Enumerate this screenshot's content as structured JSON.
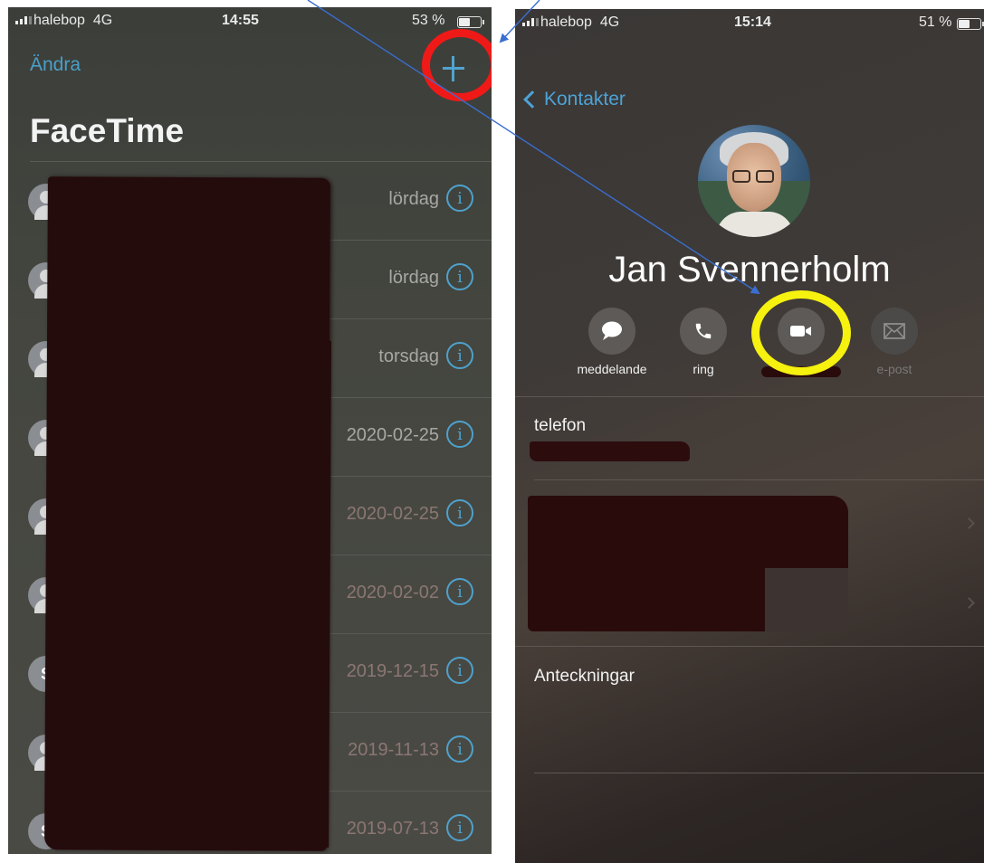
{
  "left_phone": {
    "status": {
      "carrier": "halebop",
      "network": "4G",
      "time": "14:55",
      "battery": "53 %"
    },
    "edit_label": "Ändra",
    "title": "FaceTime",
    "rows": [
      {
        "when": "lördag",
        "avatar": ""
      },
      {
        "when": "lördag",
        "avatar": ""
      },
      {
        "when": "torsdag",
        "avatar": ""
      },
      {
        "when": "2020-02-25",
        "avatar": ""
      },
      {
        "when": "2020-02-25",
        "avatar": ""
      },
      {
        "when": "2020-02-02",
        "avatar": ""
      },
      {
        "when": "2019-12-15",
        "avatar": "S"
      },
      {
        "when": "2019-11-13",
        "avatar": ""
      },
      {
        "when": "2019-07-13",
        "avatar": "S"
      }
    ],
    "info_glyph": "i"
  },
  "right_phone": {
    "status": {
      "carrier": "halebop",
      "network": "4G",
      "time": "15:14",
      "battery": "51 %"
    },
    "back_label": "Kontakter",
    "contact_name": "Jan Svennerholm",
    "actions": {
      "message": "meddelande",
      "call": "ring",
      "email": "e-post"
    },
    "fields": {
      "phone_label": "telefon",
      "notes_label": "Anteckningar"
    }
  },
  "colors": {
    "ios_blue": "#4a9fc8",
    "highlight_red": "#ef1a17",
    "highlight_yellow": "#f6f10e",
    "arrow_blue": "#3a6ed0"
  }
}
